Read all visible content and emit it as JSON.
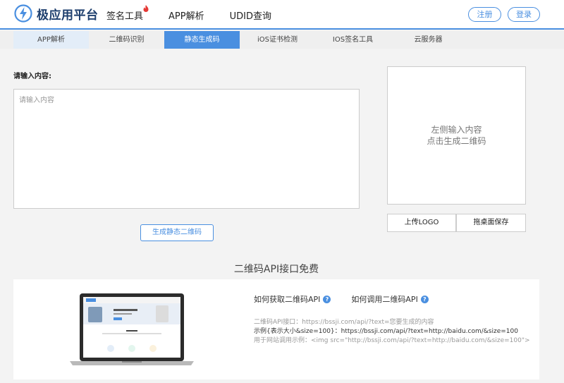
{
  "header": {
    "logo_text": "极应用平台",
    "nav": [
      {
        "label": "签名工具",
        "hot": true
      },
      {
        "label": "APP解析",
        "hot": false
      },
      {
        "label": "UDID查询",
        "hot": false
      }
    ],
    "register_label": "注册",
    "login_label": "登录"
  },
  "tabs": [
    "APP解析",
    "二维码识别",
    "静态生成码",
    "iOS证书检测",
    "IOS签名工具",
    "云服务器"
  ],
  "active_tab_index": 2,
  "form": {
    "label": "请输入内容:",
    "placeholder": "请输入内容",
    "value": "",
    "generate_label": "生成静态二维码"
  },
  "preview": {
    "line1": "左侧输入内容",
    "line2": "点击生成二维码"
  },
  "actions": {
    "upload_logo": "上传LOGO",
    "save_desktop": "拖桌面保存"
  },
  "api": {
    "section_title": "二维码API接口免费",
    "how_get": "如何获取二维码API",
    "how_call": "如何调用二维码API",
    "line1": "二维码API接口：https://bssji.com/api/?text=您要生成的内容",
    "line2": "示例{表示大小&size=100}：https://bssji.com/api/?text=http://baidu.com/&size=100",
    "line3": "用于网站调用示例：<img src=\"http://bssji.com/api/?text=http://baidu.com/&size=100\">"
  },
  "colors": {
    "accent": "#4a8fe0",
    "hot_icon": "#e53935"
  }
}
